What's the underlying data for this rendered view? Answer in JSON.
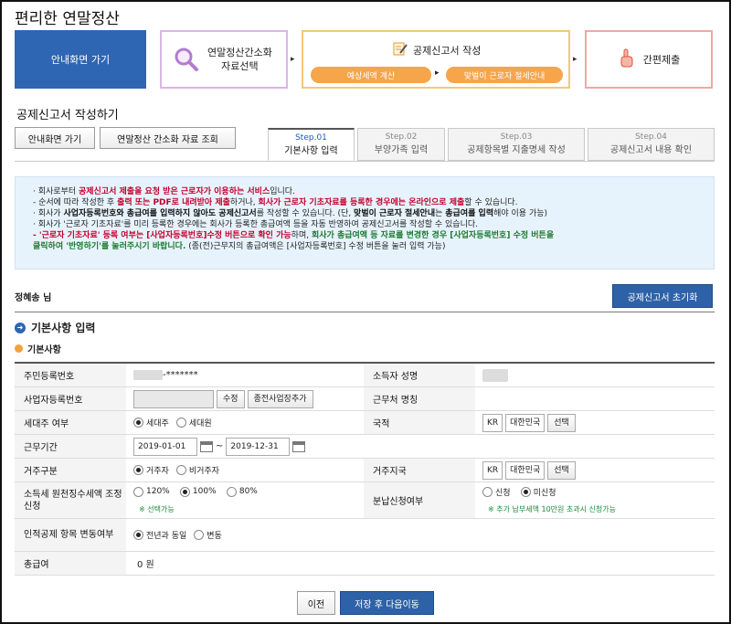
{
  "app_title": "편리한 연말정산",
  "flow": {
    "start_label": "안내화면 가기",
    "step1_line1": "연말정산간소화",
    "step1_line2": "자료선택",
    "step2_title": "공제신고서 작성",
    "step2_sub1": "예상세액 계산",
    "step2_sub2": "맞벌이 근로자 절세안내",
    "step3_label": "간편제출",
    "arrow": "▸"
  },
  "section_title": "공제신고서 작성하기",
  "buttons": {
    "home": "안내화면 가기",
    "lookup": "연말정산 간소화 자료 조회",
    "reset": "공제신고서 초기화",
    "prev": "이전",
    "next": "저장 후 다음이동"
  },
  "steps": [
    {
      "num": "Step.01",
      "label": "기본사항 입력"
    },
    {
      "num": "Step.02",
      "label": "부양가족 입력"
    },
    {
      "num": "Step.03",
      "label": "공제항목별 지출명세 작성"
    },
    {
      "num": "Step.04",
      "label": "공제신고서 내용 확인"
    }
  ],
  "info": {
    "l1_a": "· 회사로부터 ",
    "l1_b": "공제신고서 제출을 요청 받은 근로자가 이용하는 서비스",
    "l1_c": "입니다.",
    "l2_a": "- 순서에 따라 작성한 후 ",
    "l2_b": "출력 또는 PDF로 내려받아 제출",
    "l2_c": "하거나, ",
    "l2_d": "회사가 근로자 기초자료를 등록한 경우에는 온라인으로 제출",
    "l2_e": "할 수 있습니다.",
    "l3_a": "· 회사가 ",
    "l3_b": "사업자등록번호와 총급여를 입력하지 않아도 공제신고서",
    "l3_c": "를 작성할 수 있습니다. (단, ",
    "l3_d": "맞벌이 근로자 절세안내",
    "l3_e": "는 ",
    "l3_f": "총급여를 입력",
    "l3_g": "해야 이용 가능)",
    "l4": "· 회사가 '근로자 기초자료'를 미리 등록한 경우에는 회사가 등록한 총급여액 등을 자동 반영하여 공제신고서를 작성할 수 있습니다.",
    "l5_a": "- '근로자 기초자료' 등록 여부는 [사업자등록번호]수정 버튼으로 확인 가능",
    "l5_b": "하며, ",
    "l5_c": "회사가 총급여액 등 자료를 변경한 경우 [사업자등록번호] 수정 버튼을",
    "l6_a": "클릭하여 '반영하기'를 눌러주시기 바랍니다.",
    "l6_b": " (종(전)근무지의 총급여액은 [사업자등록번호] 수정 버튼을 눌러 입력 가능)"
  },
  "user_name": "정혜송 님",
  "basic_section": "기본사항 입력",
  "basic_sub": "기본사항",
  "form": {
    "rrn_label": "주민등록번호",
    "rrn_masked": "-*******",
    "name_label": "소득자 성명",
    "bizno_label": "사업자등록번호",
    "edit_btn": "수정",
    "add_btn": "종전사업장추가",
    "workplace_label": "근무처 명칭",
    "household_label": "세대주 여부",
    "household_opts": [
      "세대주",
      "세대원"
    ],
    "nationality_label": "국적",
    "nat_code": "KR",
    "nat_name": "대한민국",
    "select_btn": "선택",
    "period_label": "근무기간",
    "start_date": "2019-01-01",
    "end_date": "2019-12-31",
    "tilde": "~",
    "residency_label": "거주구분",
    "residency_opts": [
      "거주자",
      "비거주자"
    ],
    "country_label": "거주지국",
    "country_code": "KR",
    "country_name": "대한민국",
    "withholding_label": "소득세 원천징수세액 조정신청",
    "withholding_opts": [
      "120%",
      "100%",
      "80%"
    ],
    "withholding_note": "※ 선택가능",
    "installment_label": "분납신청여부",
    "installment_opts": [
      "신청",
      "미신청"
    ],
    "installment_note": "※ 추가 납부세액 10만원 초과시 신청가능",
    "deduction_label": "인적공제 항목 변동여부",
    "deduction_opts": [
      "전년과 동일",
      "변동"
    ],
    "salary_label": "총급여",
    "salary_value": "0 원"
  }
}
